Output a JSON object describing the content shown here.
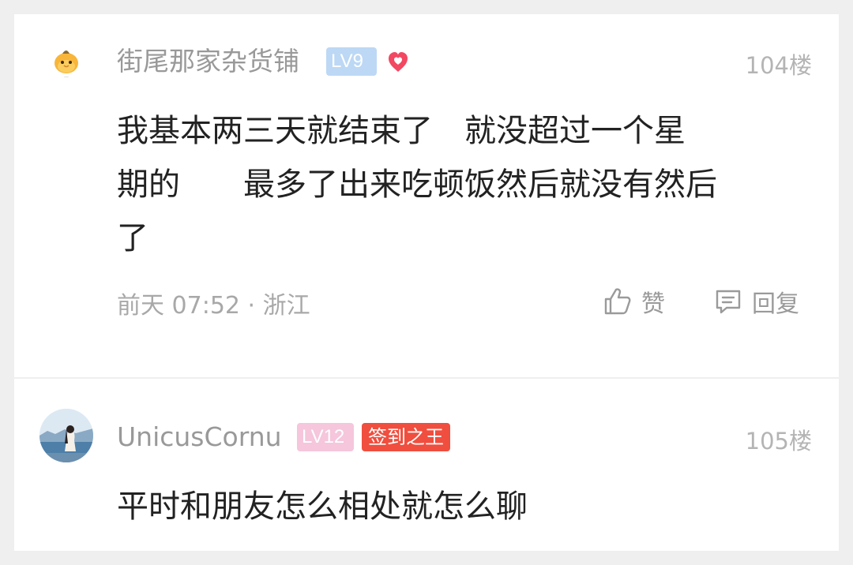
{
  "comments": [
    {
      "username": "街尾那家杂货铺",
      "level": "LV9",
      "floor": "104楼",
      "content": "我基本两三天就结束了　就没超过一个星\n期的　　最多了出来吃顿饭然后就没有然后\n了",
      "meta": "前天 07:52 · 浙江",
      "like_label": "赞",
      "reply_label": "回复",
      "avatar_icon": "orange-chick-avatar",
      "badge_icon": "heart-icon"
    },
    {
      "username": "UnicusCornu",
      "level": "LV12",
      "badge": "签到之王",
      "floor": "105楼",
      "content": "平时和朋友怎么相处就怎么聊",
      "avatar_icon": "photo-avatar"
    }
  ],
  "colors": {
    "background": "#efefef",
    "card": "#ffffff",
    "level_blue": "#bcd8f5",
    "level_pink": "#f5c6dc",
    "badge_red": "#f04e3e",
    "heart_red": "#f24862"
  }
}
